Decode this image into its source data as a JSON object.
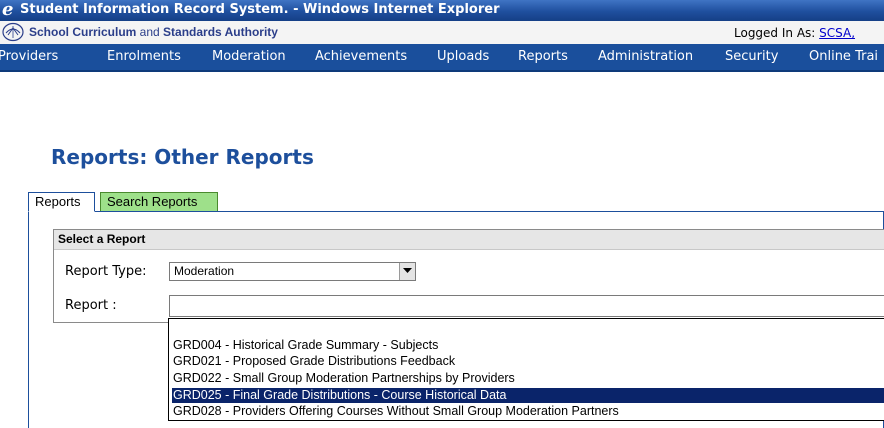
{
  "window": {
    "title": "Student Information Record System. - Windows Internet Explorer"
  },
  "header": {
    "org_bold_1": "School Curriculum",
    "org_and": " and ",
    "org_bold_2": "Standards Authority",
    "logged_in_label": "Logged In As: ",
    "logged_in_user": "SCSA,"
  },
  "nav": {
    "items": [
      "Providers",
      "Enrolments",
      "Moderation",
      "Achievements",
      "Uploads",
      "Reports",
      "Administration",
      "Security",
      "Online Trai"
    ]
  },
  "page": {
    "title": "Reports: Other Reports"
  },
  "tabs": [
    {
      "label": "Reports",
      "active": true
    },
    {
      "label": "Search Reports",
      "active": false
    }
  ],
  "form": {
    "section_title": "Select a Report",
    "report_type_label": "Report Type:",
    "report_type_value": "Moderation",
    "report_label": "Report :"
  },
  "dropdown": {
    "options": [
      "GRD004 - Historical Grade Summary - Subjects",
      "GRD021 - Proposed Grade Distributions Feedback",
      "GRD022 - Small Group Moderation Partnerships by Providers",
      "GRD025 - Final Grade Distributions - Course Historical Data",
      "GRD028 - Providers Offering Courses Without Small Group Moderation Partners"
    ],
    "selected_index": 3
  },
  "colors": {
    "titlebar": "#1f4f9e",
    "nav": "#1a4f9c",
    "page_title": "#1d4f9c",
    "search_tab": "#9ee08a",
    "selection": "#0a246a"
  }
}
